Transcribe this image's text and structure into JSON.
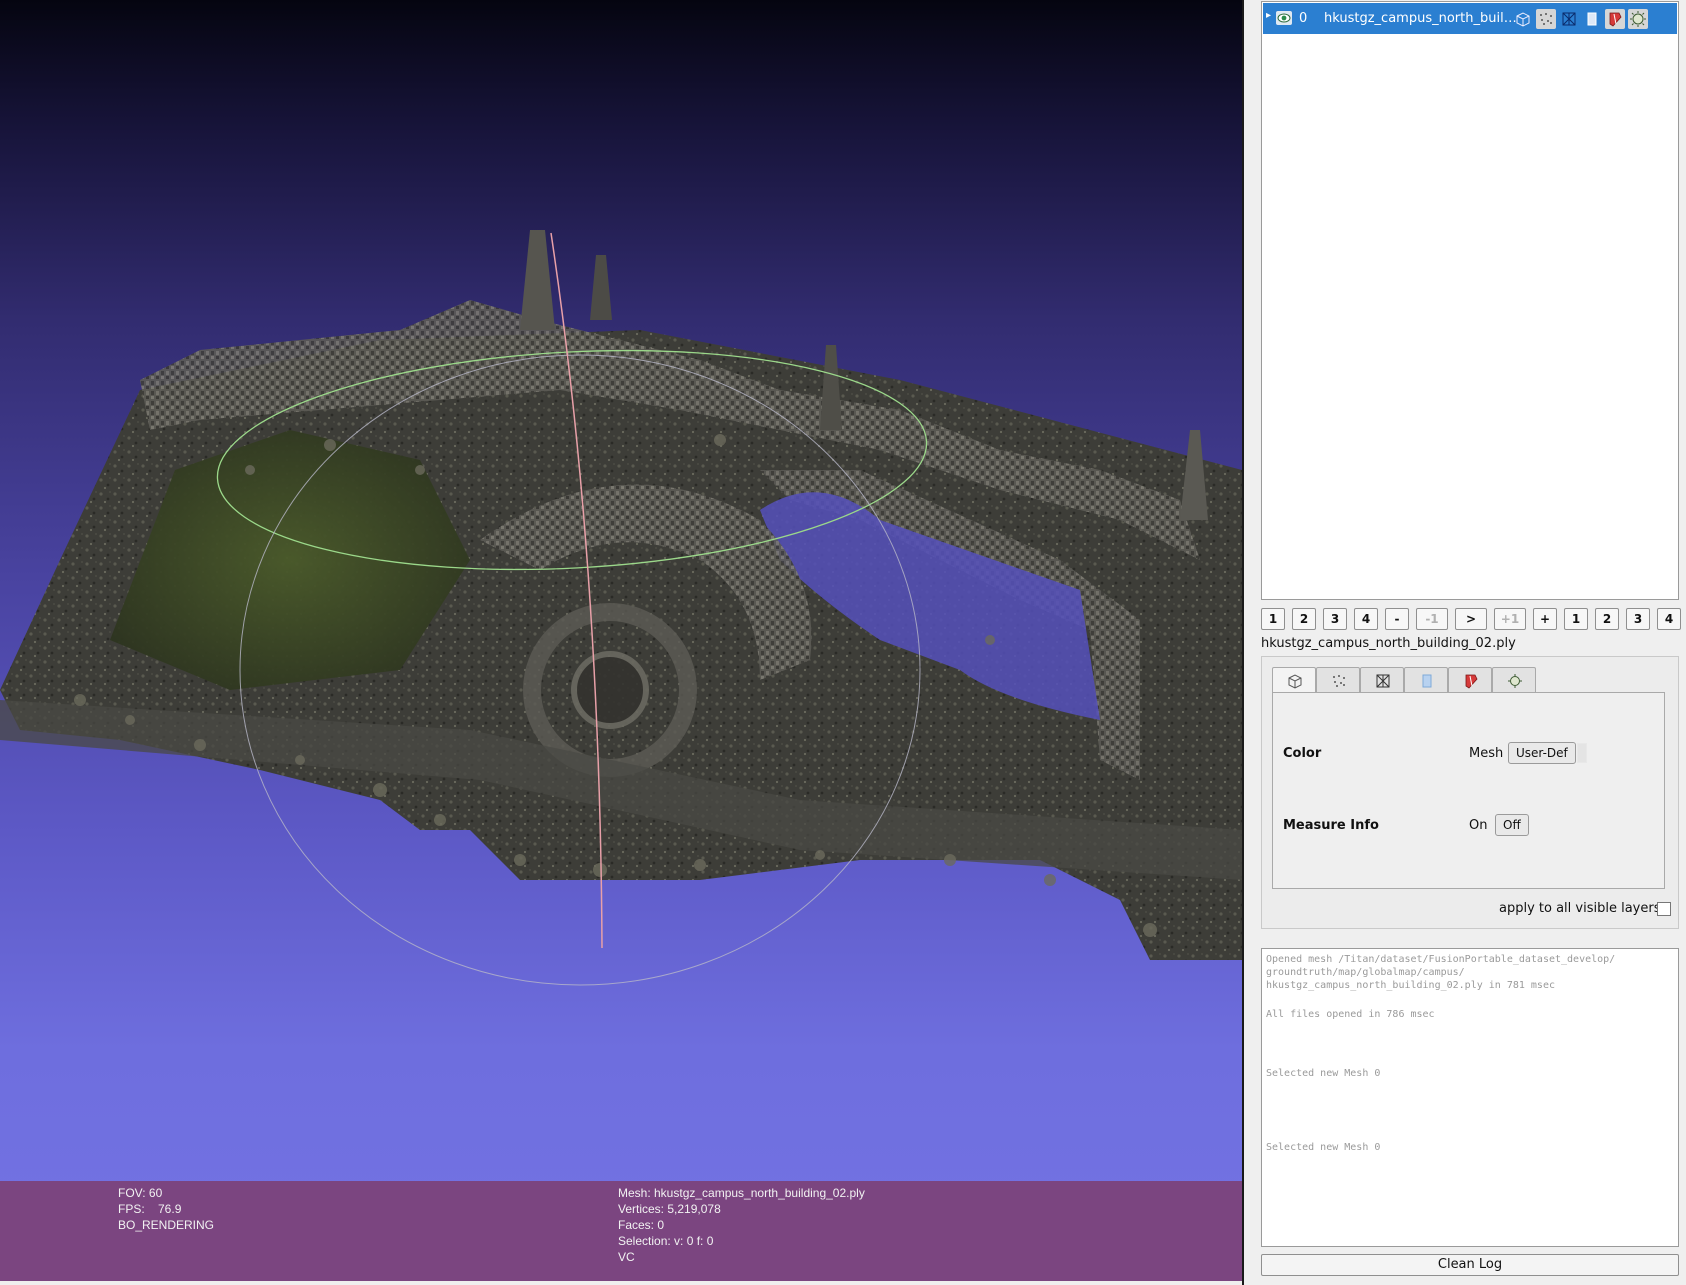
{
  "viewport": {
    "info_left": [
      "FOV: 60",
      "FPS:    76.9",
      "BO_RENDERING"
    ],
    "info_right": [
      "Mesh: hkustgz_campus_north_building_02.ply",
      "Vertices: 5,219,078",
      "Faces: 0",
      "Selection: v: 0 f: 0",
      "VC"
    ]
  },
  "layers": {
    "rows": [
      {
        "index": "0",
        "name": "hkustgz_campus_north_buildi..."
      }
    ]
  },
  "shortcut_buttons": [
    "1",
    "2",
    "3",
    "4",
    "-",
    "-1",
    ">",
    "+1",
    "+",
    "1",
    "2",
    "3",
    "4"
  ],
  "current_mesh_file": "hkustgz_campus_north_building_02.ply",
  "properties": {
    "tabs": [
      "box-render-icon",
      "points-render-icon",
      "wireframe-render-icon",
      "texture-render-icon",
      "colorize-render-icon",
      "lighting-render-icon"
    ],
    "color": {
      "label": "Color",
      "mode_label": "Mesh",
      "button": "User-Def"
    },
    "measure": {
      "label": "Measure Info",
      "on_label": "On",
      "off_button": "Off"
    },
    "apply_all": "apply to all visible layers"
  },
  "log": {
    "lines": [
      "Opened mesh /Titan/dataset/FusionPortable_dataset_develop/",
      "groundtruth/map/globalmap/campus/",
      "hkustgz_campus_north_building_02.ply in 781 msec",
      "All files opened in 786 msec",
      "Selected new Mesh 0",
      "Selected new Mesh 0"
    ],
    "clean_button": "Clean Log"
  },
  "colors": {
    "selection_blue": "#2b7fd1",
    "info_bar": "#7b4580",
    "trackball_green": "#9bd88a",
    "trackball_red": "#e8a0a8"
  }
}
